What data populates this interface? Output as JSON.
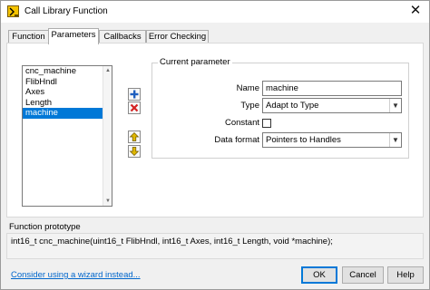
{
  "window": {
    "title": "Call Library Function",
    "close_glyph": "✕"
  },
  "tabs": [
    {
      "label": "Function",
      "active": false
    },
    {
      "label": "Parameters",
      "active": true
    },
    {
      "label": "Callbacks",
      "active": false
    },
    {
      "label": "Error Checking",
      "active": false
    }
  ],
  "parameters": {
    "list": [
      "cnc_machine",
      "FlibHndl",
      "Axes",
      "Length",
      "machine"
    ],
    "selected_index": 4,
    "buttons": [
      {
        "name": "add-parameter-icon",
        "color": "#1f5fbf"
      },
      {
        "name": "delete-parameter-icon",
        "color": "#d42020"
      },
      {
        "name": "move-up-icon",
        "color": "#e0b800"
      },
      {
        "name": "move-down-icon",
        "color": "#e0b800"
      }
    ]
  },
  "current_parameter": {
    "legend": "Current parameter",
    "name_label": "Name",
    "name_value": "machine",
    "type_label": "Type",
    "type_value": "Adapt to Type",
    "constant_label": "Constant",
    "constant_checked": false,
    "data_format_label": "Data format",
    "data_format_value": "Pointers to Handles"
  },
  "prototype": {
    "label": "Function prototype",
    "text": "int16_t cnc_machine(uint16_t FlibHndl, int16_t Axes, int16_t Length, void *machine);"
  },
  "footer": {
    "wizard_link": "Consider using a wizard instead...",
    "ok": "OK",
    "cancel": "Cancel",
    "help": "Help"
  },
  "colors": {
    "accent": "#0078d7",
    "link": "#0066cc",
    "app_icon": "#f5c400"
  }
}
